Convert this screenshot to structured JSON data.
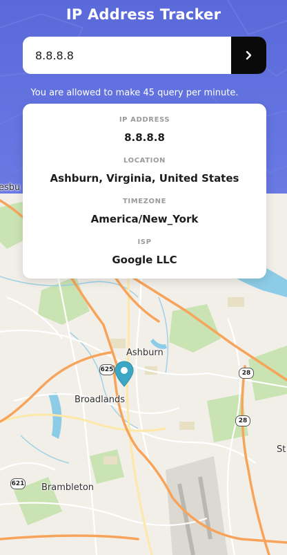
{
  "header": {
    "title": "IP Address Tracker",
    "accent_color": "#5a69d9"
  },
  "search": {
    "value": "8.8.8.8",
    "button_icon": "chevron-right-icon"
  },
  "note": "You are allowed to make 45 query per minute.",
  "info": {
    "ip_label": "IP ADDRESS",
    "ip_value": "8.8.8.8",
    "location_label": "LOCATION",
    "location_value": "Ashburn, Virginia, United States",
    "timezone_label": "TIMEZONE",
    "timezone_value": "America/New_York",
    "isp_label": "ISP",
    "isp_value": "Google LLC"
  },
  "map": {
    "places": {
      "ashburn": "Ashburn",
      "broadlands": "Broadlands",
      "brambleton": "Brambleton",
      "partial_left": "esbu",
      "partial_right": "St"
    },
    "shields": {
      "r625": "625",
      "r28a": "28",
      "r28b": "28",
      "r621": "621"
    },
    "marker_icon": "map-pin-icon",
    "marker_color": "#3ba7c4"
  }
}
